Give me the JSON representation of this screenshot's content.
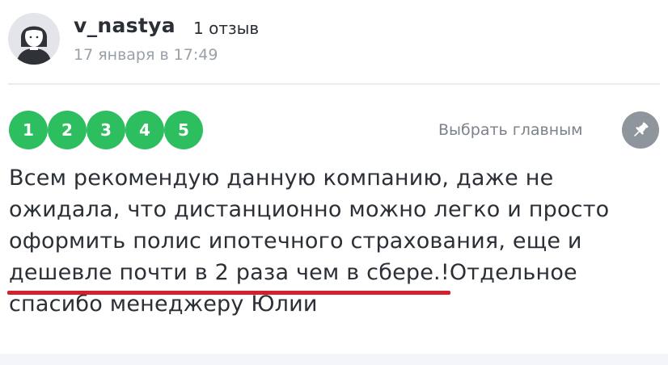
{
  "review": {
    "username": "v_nastya",
    "review_count": "1 отзыв",
    "date": "17 января в 17:49",
    "rating": {
      "scale": [
        "1",
        "2",
        "3",
        "4",
        "5"
      ],
      "selected": 5
    },
    "pin_label": "Выбрать главным",
    "text": "Всем рекомендую данную компанию, даже не ожидала, что дистанционно можно легко и просто оформить полис ипотечного страхования, еще и дешевле почти в 2 раза чем в сбере.!Отдельное спасибо менеджеру Юлии"
  },
  "icons": {
    "avatar": "user-avatar-icon",
    "pin": "pin-icon"
  },
  "colors": {
    "rating_green": "#2dbe60",
    "pin_gray": "#8f959d",
    "underline_red": "#d3202b",
    "text_dark": "#2b2f36",
    "text_muted": "#9aa0a8"
  }
}
